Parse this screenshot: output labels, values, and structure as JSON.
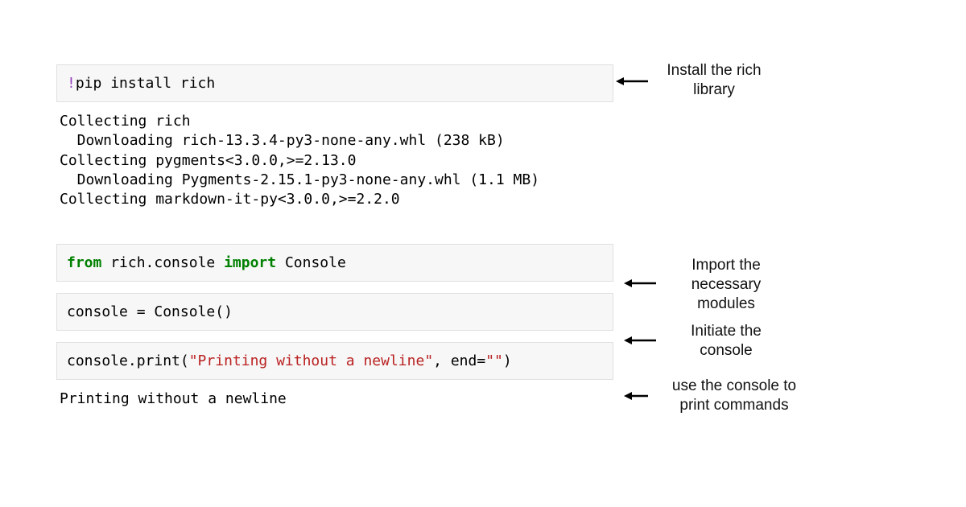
{
  "cells": {
    "install": {
      "bang": "!",
      "cmd": "pip install rich"
    },
    "install_output": "Collecting rich\n  Downloading rich-13.3.4-py3-none-any.whl (238 kB)\nCollecting pygments<3.0.0,>=2.13.0\n  Downloading Pygments-2.15.1-py3-none-any.whl (1.1 MB)\nCollecting markdown-it-py<3.0.0,>=2.2.0",
    "import": {
      "from_kw": "from",
      "module": " rich.console ",
      "import_kw": "import",
      "name": " Console"
    },
    "init": {
      "line": "console = Console()"
    },
    "print": {
      "prefix": "console.print(",
      "str1": "\"Printing without a newline\"",
      "mid": ", end=",
      "str2": "\"\"",
      "suffix": ")"
    },
    "print_output": "Printing without a newline"
  },
  "annotations": {
    "install": "Install the rich\nlibrary",
    "import": "Import the\nnecessary\nmodules",
    "init": "Initiate the\nconsole",
    "print": "use the console to\nprint commands"
  }
}
